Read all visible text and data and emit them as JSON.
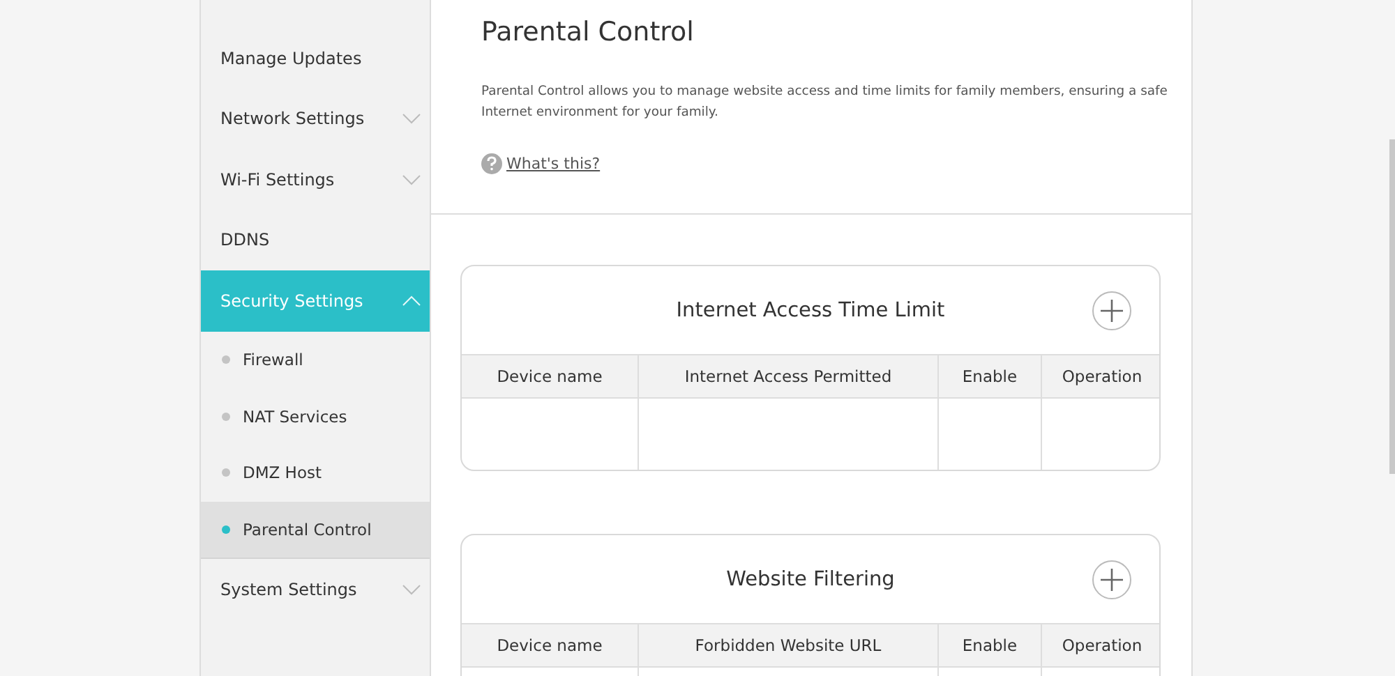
{
  "sidebar": {
    "items": [
      {
        "label": "Manage Updates",
        "kind": "item",
        "selected": false
      },
      {
        "label": "Network Settings",
        "kind": "group",
        "expanded": false,
        "selected": false
      },
      {
        "label": "Wi-Fi Settings",
        "kind": "group",
        "expanded": false,
        "selected": false
      },
      {
        "label": "DDNS",
        "kind": "item",
        "selected": false
      },
      {
        "label": "Security Settings",
        "kind": "group",
        "expanded": true,
        "selected": true,
        "children": [
          {
            "label": "Firewall",
            "selected": false
          },
          {
            "label": "NAT Services",
            "selected": false
          },
          {
            "label": "DMZ Host",
            "selected": false
          },
          {
            "label": "Parental Control",
            "selected": true
          }
        ]
      },
      {
        "label": "System Settings",
        "kind": "group",
        "expanded": false,
        "selected": false
      }
    ]
  },
  "page": {
    "title": "Parental Control",
    "description": "Parental Control allows you to manage website access and time limits for family members, ensuring a safe Internet environment for your family.",
    "help_link": "What's this?"
  },
  "tables": [
    {
      "title": "Internet Access Time Limit",
      "columns": [
        "Device name",
        "Internet Access Permitted",
        "Enable",
        "Operation"
      ]
    },
    {
      "title": "Website Filtering",
      "columns": [
        "Device name",
        "Forbidden Website URL",
        "Enable",
        "Operation"
      ]
    }
  ]
}
